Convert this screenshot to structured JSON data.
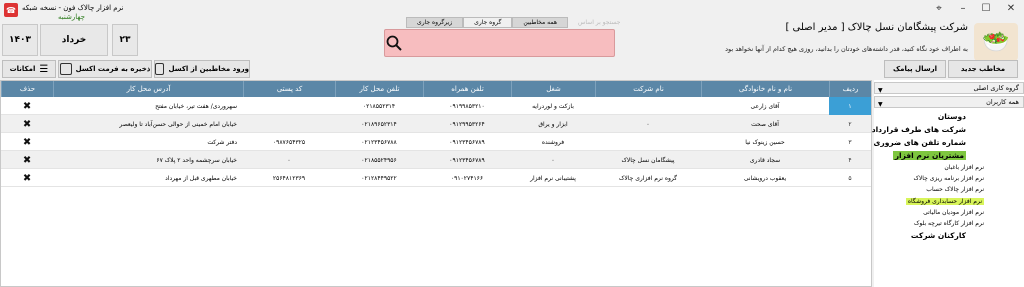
{
  "window": {
    "title": "نرم افزار چالاک فون - نسخه شبکه",
    "weekday": "چهارشنبه"
  },
  "date": {
    "year": "۱۴۰۳",
    "month": "خرداد",
    "day": "۲۳"
  },
  "header": {
    "company": "شرکت پیشگامان نسل چالاک [ مدیر اصلی ]",
    "slogan": "به اطراف خود نگاه کنید، قدر داشته‌های خودتان را بدانید، روزی هیچ کدام از آنها نخواهد بود"
  },
  "search": {
    "tabs": [
      "جستجو بر اساس",
      "همه مخاطبین",
      "گروه جاری",
      "زیرگروه جاری"
    ],
    "active_tab": "گروه جاری"
  },
  "toolbar": {
    "new_contact": "مخاطب جدید",
    "send_sms": "ارسال پیامک",
    "import_excel": "ورود مخاطبین از اکسل",
    "save_excel": "ذخیره به فرمت اکسل",
    "options": "امکانات"
  },
  "grid": {
    "columns": [
      "ردیف",
      "نام و نام خانوادگی",
      "نام شرکت",
      "شغل",
      "تلفن همراه",
      "تلفن محل کار",
      "کد پستی",
      "آدرس محل کار",
      "حذف"
    ],
    "rows": [
      {
        "idx": "۱",
        "name": "آقای زارعی",
        "company": "",
        "job": "بازکت و لوردرایه",
        "mobile": "۰۹۱۹۹۸۵۳۲۱۰",
        "work": "۰۲۱۸۵۵۲۳۱۴",
        "postal": "",
        "address": "سهروردی/ هفت تیر، خیابان مفتح"
      },
      {
        "idx": "۲",
        "name": "آقای صحت",
        "company": "۰",
        "job": "ابزار و یراق",
        "mobile": "۰۹۱۲۹۹۵۳۲۶۴",
        "work": "۰۲۱۸۹۶۵۲۳۱۴",
        "postal": "",
        "address": "خیابان امام خمینی از حوالی حسن‌آباد تا ولیعصر"
      },
      {
        "idx": "۳",
        "name": "حسین زینوک نیا",
        "company": "",
        "job": "فروشنده",
        "mobile": "۰۹۱۲۳۴۵۶۷۸۹",
        "work": "۰۲۱۲۳۴۵۶۷۸۸",
        "postal": "۰۹۸۷۶۵۴۳۲۵",
        "address": "دفتر شرکت"
      },
      {
        "idx": "۴",
        "name": "سجاد قادری",
        "company": "پیشگامان نسل چالاک",
        "job": "۰",
        "mobile": "۰۹۱۲۳۴۵۶۷۸۹",
        "work": "۰۲۱۸۵۵۲۴۹۵۶",
        "postal": "۰",
        "address": "خیابان سرچشمه واحد ۲ پلاک ۶۷"
      },
      {
        "idx": "۵",
        "name": "یعقوب درویشانی",
        "company": "گروه نرم افزاری چالاک",
        "job": "پشتیبانی نرم افزار",
        "mobile": "۰۹۱۰۲۷۴۱۶۶",
        "work": "۰۲۱۲۸۴۴۹۵۲۲",
        "postal": "۲۵۶۴۸۱۲۳۶۹",
        "address": "خیابان مطهری قبل از مهرداد"
      }
    ]
  },
  "sidebar": {
    "combo1": "گروه کاری اصلی",
    "combo2": "همه کاربران",
    "tree": [
      {
        "label": "دوستان",
        "level": 0,
        "hl": ""
      },
      {
        "label": "شرکت های طرف قرارداد",
        "level": 0,
        "hl": ""
      },
      {
        "label": "شماره تلفن های ضروری",
        "level": 0,
        "hl": ""
      },
      {
        "label": "مشتریان نرم افزار",
        "level": 0,
        "hl": "green"
      },
      {
        "label": "نرم افزار باغبان",
        "level": 1,
        "hl": ""
      },
      {
        "label": "نرم افزار برنامه ریزی چالاک",
        "level": 1,
        "hl": ""
      },
      {
        "label": "نرم افزار چالاک حساب",
        "level": 1,
        "hl": ""
      },
      {
        "label": "نرم افزار حسابداری فروشگاه",
        "level": 1,
        "hl": "yellow"
      },
      {
        "label": "نرم افزار مودیان مالیاتی",
        "level": 1,
        "hl": ""
      },
      {
        "label": "نرم افزار کارگاه تیرچه بلوک",
        "level": 1,
        "hl": ""
      },
      {
        "label": "کارکنان شرکت",
        "level": 0,
        "hl": ""
      }
    ]
  },
  "colors": {
    "header": "#5b87a7",
    "search": "#f7bdbf",
    "selected_index": "#3b9fd6",
    "tree_hl": "#7ec63f"
  },
  "icons": {
    "search": "search-icon",
    "close": "close-icon",
    "delete": "delete-x-icon"
  }
}
